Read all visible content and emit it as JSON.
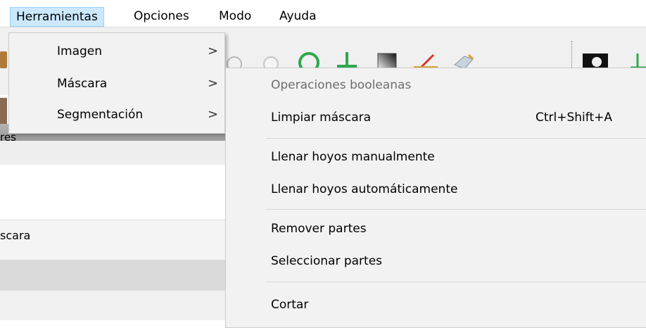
{
  "menubar": {
    "items": [
      {
        "label": "Herramientas",
        "active": true
      },
      {
        "label": "Opciones"
      },
      {
        "label": "Modo"
      },
      {
        "label": "Ayuda"
      }
    ]
  },
  "toolbar": {
    "icons": [
      "ellipse-select-icon",
      "circle-select-icon",
      "green-ring-icon",
      "green-cross-icon",
      "gradient-icon",
      "measure-icon",
      "eraser-icon",
      "mask-icon",
      "green-plus-icon"
    ]
  },
  "background": {
    "panel_text_1": "res",
    "panel_text_2": "scara"
  },
  "herramientas_menu": {
    "items": [
      {
        "label": "Imagen",
        "arrow": ">"
      },
      {
        "label": "Máscara",
        "arrow": ">"
      },
      {
        "label": "Segmentación",
        "arrow": ">"
      }
    ]
  },
  "mascara_submenu": {
    "items": [
      {
        "label": "Operaciones booleanas",
        "disabled": true,
        "shortcut": ""
      },
      {
        "label": "Limpiar máscara",
        "shortcut": "Ctrl+Shift+A"
      },
      {
        "label": "Llenar hoyos manualmente",
        "shortcut": ""
      },
      {
        "label": "Llenar hoyos automáticamente",
        "shortcut": ""
      },
      {
        "label": "Remover partes",
        "shortcut": ""
      },
      {
        "label": "Seleccionar partes",
        "shortcut": ""
      },
      {
        "label": "Cortar",
        "shortcut": ""
      }
    ]
  },
  "colors": {
    "menu_highlight": "#cce8ff",
    "menu_highlight_border": "#99d1ff",
    "menu_background": "#f2f2f2",
    "disabled_text": "#6d6d6d",
    "icon_green": "#2fa84f"
  }
}
